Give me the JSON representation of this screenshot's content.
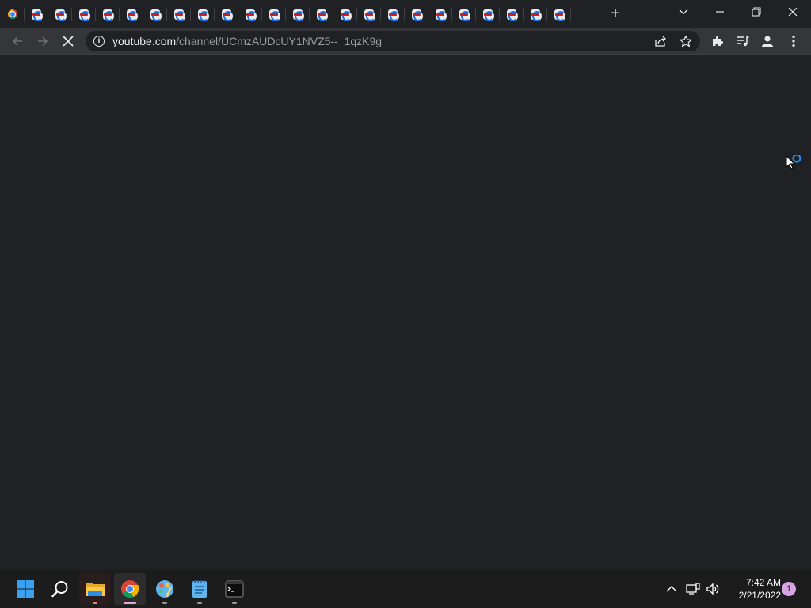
{
  "browser": {
    "tabs_layout": [
      "chrome",
      "sep",
      "yt",
      "sep",
      "yt",
      "sep",
      "yt",
      "sep",
      "yt",
      "sep",
      "yt",
      "sep",
      "yt",
      "sep",
      "yt",
      "sep",
      "yt",
      "sep",
      "yt",
      "sep",
      "yt",
      "sep",
      "yt",
      "sep",
      "yt",
      "sep",
      "yt",
      "sep",
      "yt",
      "sep",
      "yt",
      "sep",
      "yt",
      "sep",
      "yt",
      "sep",
      "yt",
      "sep",
      "yt",
      "sep",
      "yt",
      "sep",
      "yt",
      "sep",
      "yt",
      "sep",
      "yt",
      "sep",
      "yt",
      "sep",
      "yt",
      "sep",
      "yt",
      "sep",
      "yt",
      "sep",
      "yt",
      "sep",
      "yt",
      "sep",
      "dl",
      "sep",
      "yt",
      "sep",
      "yt",
      "sep",
      "yt",
      "sep",
      "yt",
      "sep",
      "yt",
      "sep",
      "yt",
      "sep",
      "yt",
      "sep",
      "yt",
      "sep",
      "yt",
      "sep",
      "yt",
      "sep",
      "yt",
      "sep",
      "yt",
      "sep",
      "yt",
      "sep",
      "yt",
      "sep",
      "yt",
      "sep",
      "yt",
      "sep",
      "yt",
      "sep",
      "yt",
      "sep",
      "yt",
      "sep",
      "yt"
    ],
    "new_tab_label": "+",
    "url_host": "youtube.com",
    "url_path": "/channel/UCmzAUDcUY1NVZ5--_1qzK9g",
    "icons": {
      "back": "back-arrow-icon",
      "forward": "forward-arrow-icon",
      "stop": "stop-loading-icon",
      "info": "site-info-icon",
      "share": "share-icon",
      "bookmark": "star-icon",
      "extensions": "puzzle-icon",
      "media": "media-controls-icon",
      "profile": "profile-icon",
      "menu": "kebab-menu-icon"
    }
  },
  "taskbar": {
    "apps": [
      "start",
      "search",
      "file-explorer",
      "chrome",
      "paint",
      "notepad",
      "terminal"
    ],
    "clock_time": "7:42 AM",
    "clock_date": "2/21/2022",
    "notification_count": "1"
  },
  "colors": {
    "page_bg": "#202124",
    "toolbar_bg": "#35363a",
    "taskbar_bg": "#1c1c1c",
    "accent_blue": "#1a73e8",
    "notification": "#d7a4e6"
  }
}
